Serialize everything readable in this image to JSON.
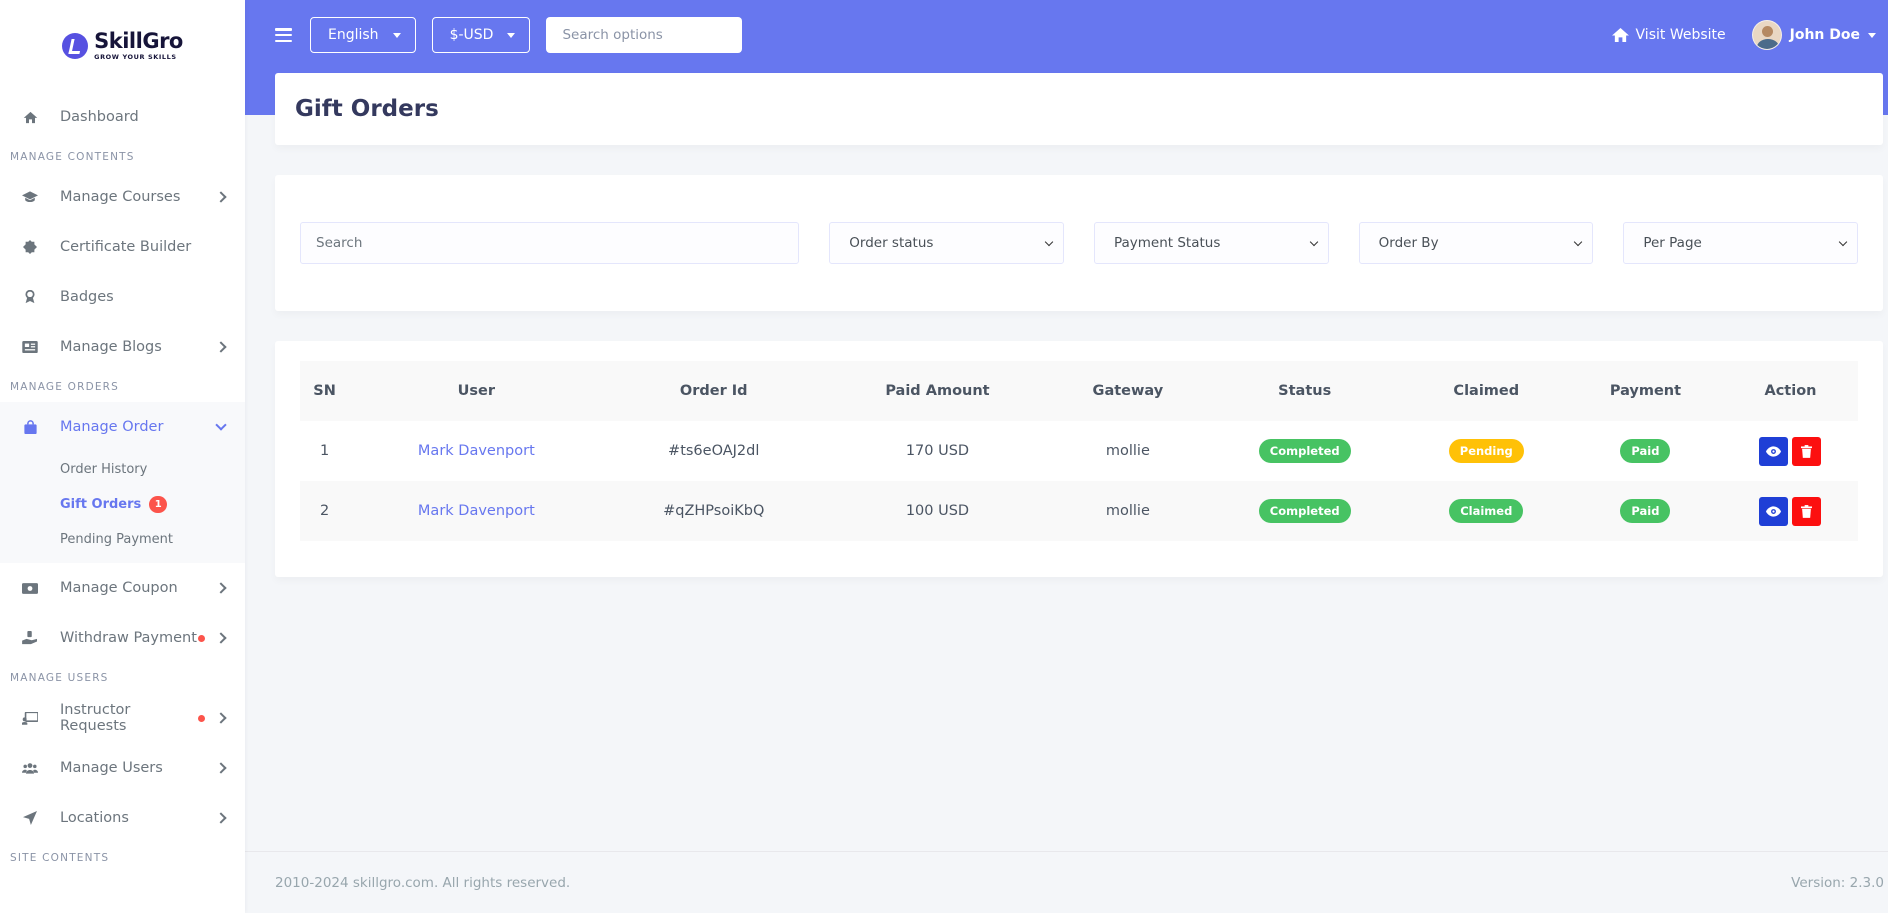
{
  "brand": {
    "name": "SkillGro",
    "tagline": "GROW YOUR SKILLS"
  },
  "sidebar": {
    "items": [
      {
        "type": "item",
        "label": "Dashboard",
        "icon": "home-icon"
      },
      {
        "type": "header",
        "label": "MANAGE CONTENTS"
      },
      {
        "type": "item",
        "label": "Manage Courses",
        "icon": "graduation-cap-icon",
        "chevron": true
      },
      {
        "type": "item",
        "label": "Certificate Builder",
        "icon": "certificate-icon"
      },
      {
        "type": "item",
        "label": "Badges",
        "icon": "award-icon"
      },
      {
        "type": "item",
        "label": "Manage Blogs",
        "icon": "newspaper-icon",
        "chevron": true
      },
      {
        "type": "header",
        "label": "MANAGE ORDERS"
      },
      {
        "type": "item",
        "label": "Manage Order",
        "icon": "shopping-bag-icon",
        "chevron": true,
        "active": true,
        "children": [
          {
            "label": "Order History"
          },
          {
            "label": "Gift Orders",
            "active": true,
            "badge": "1"
          },
          {
            "label": "Pending Payment"
          }
        ]
      },
      {
        "type": "item",
        "label": "Manage Coupon",
        "icon": "money-bill-icon",
        "chevron": true
      },
      {
        "type": "item",
        "label": "Withdraw Payment",
        "icon": "hand-holding-icon",
        "chevron": true,
        "dot": true
      },
      {
        "type": "header",
        "label": "MANAGE USERS"
      },
      {
        "type": "item",
        "label": "Instructor Requests",
        "icon": "chalkboard-icon",
        "chevron": true,
        "dot": true
      },
      {
        "type": "item",
        "label": "Manage Users",
        "icon": "users-icon",
        "chevron": true
      },
      {
        "type": "item",
        "label": "Locations",
        "icon": "location-arrow-icon",
        "chevron": true
      },
      {
        "type": "header",
        "label": "SITE CONTENTS"
      }
    ]
  },
  "topbar": {
    "language": "English",
    "currency": "$-USD",
    "search_placeholder": "Search options",
    "visit_website": "Visit Website",
    "user_name": "John Doe"
  },
  "page": {
    "title": "Gift Orders"
  },
  "filters": {
    "search_placeholder": "Search",
    "order_status": "Order status",
    "payment_status": "Payment Status",
    "order_by": "Order By",
    "per_page": "Per Page"
  },
  "table": {
    "columns": [
      "SN",
      "User",
      "Order Id",
      "Paid Amount",
      "Gateway",
      "Status",
      "Claimed",
      "Payment",
      "Action"
    ],
    "rows": [
      {
        "sn": "1",
        "user": "Mark Davenport",
        "order_id": "#ts6eOAJ2dl",
        "amount": "170 USD",
        "gateway": "mollie",
        "status": "Completed",
        "claimed": "Pending",
        "payment": "Paid"
      },
      {
        "sn": "2",
        "user": "Mark Davenport",
        "order_id": "#qZHPsoiKbQ",
        "amount": "100 USD",
        "gateway": "mollie",
        "status": "Completed",
        "claimed": "Claimed",
        "payment": "Paid"
      }
    ]
  },
  "footer": {
    "copyright": "2010-2024 skillgro.com. All rights reserved.",
    "version": "Version: 2.3.0"
  },
  "colors": {
    "primary": "#6777ef",
    "success": "#47c363",
    "warning": "#ffc107",
    "danger": "#fc0f0f",
    "view": "#1f3fd6"
  }
}
